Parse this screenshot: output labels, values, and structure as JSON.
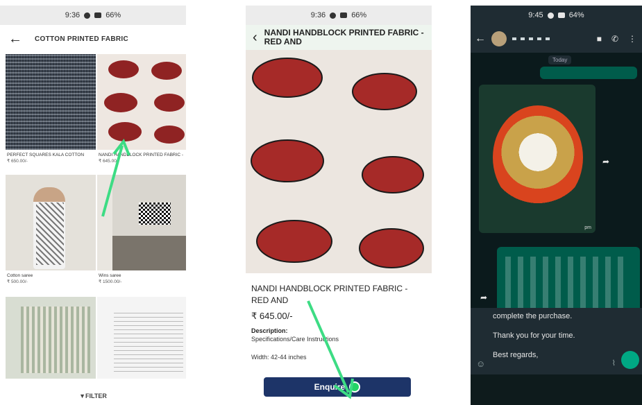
{
  "panel1": {
    "status_time": "9:36",
    "status_battery": "66%",
    "title": "COTTON PRINTED FABRIC",
    "products": [
      {
        "name": "PERFECT SQUARES KALA COTTON",
        "price": "₹ 650.00/-"
      },
      {
        "name": "NANDI HANDBLOCK PRINTED FABRIC -",
        "price": "₹ 645.00/-"
      },
      {
        "name": "Cotton saree",
        "price": "₹ 500.00/-"
      },
      {
        "name": "Wins saree",
        "price": "₹ 1500.00/-"
      }
    ],
    "filter_label": "FILTER"
  },
  "panel2": {
    "status_time": "9:36",
    "status_battery": "66%",
    "header_title": "NANDI HANDBLOCK PRINTED FABRIC - RED AND",
    "product_name": "NANDI HANDBLOCK PRINTED FABRIC - RED AND",
    "price": "₹ 645.00/-",
    "description_label": "Description:",
    "description_text": "Specifications/Care Instructions",
    "width_text": "Width: 42-44 inches",
    "enquire_label": "Enquire"
  },
  "panel3": {
    "status_time": "9:45",
    "status_battery": "64%",
    "day_label": "Today",
    "photo_time": "pm",
    "typed_lines": [
      "complete the purchase.",
      "Thank you for your time.",
      "Best regards,"
    ]
  },
  "colors": {
    "accent_arrow": "#3ddc84",
    "enquire_bg": "#1d3468",
    "whatsapp_green": "#25d366",
    "chat_bubble": "#005c4b"
  }
}
